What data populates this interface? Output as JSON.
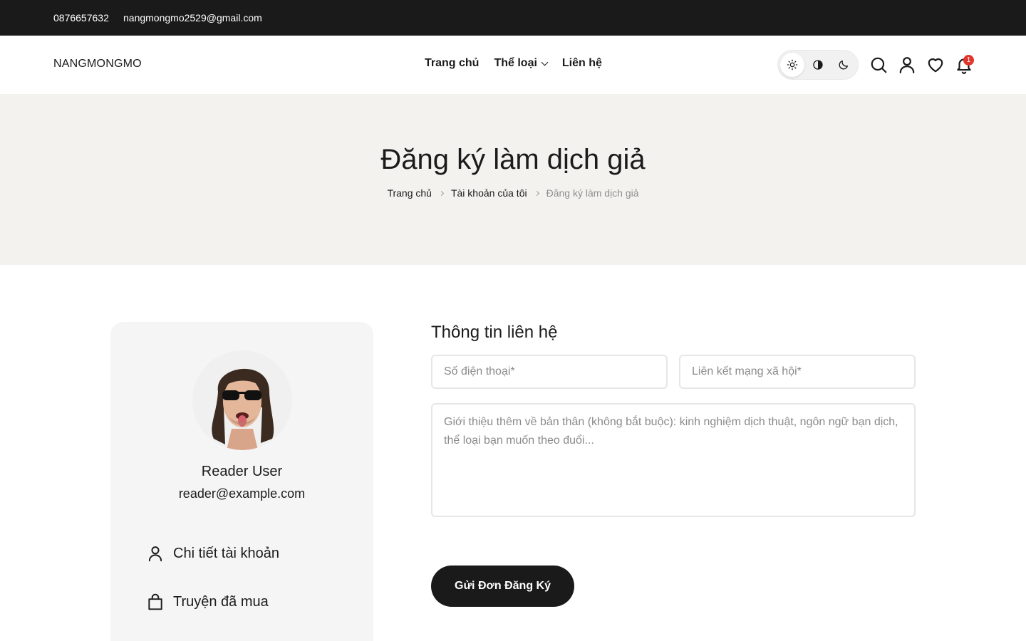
{
  "topbar": {
    "phone": "0876657632",
    "email": "nangmongmo2529@gmail.com"
  },
  "header": {
    "logo": "NANGMONGMO",
    "nav": [
      {
        "label": "Trang chủ"
      },
      {
        "label": "Thể loại",
        "has_dropdown": true
      },
      {
        "label": "Liên hệ"
      }
    ],
    "theme_modes": [
      "light-icon",
      "contrast-icon",
      "moon-icon"
    ],
    "active_theme": "light",
    "icons": [
      "search-icon",
      "user-icon",
      "heart-icon",
      "bell-icon"
    ],
    "notification_count": "1"
  },
  "hero": {
    "title": "Đăng ký làm dịch giả",
    "breadcrumb": [
      "Trang chủ",
      "Tài khoản của tôi",
      "Đăng ký làm dịch giả"
    ]
  },
  "sidebar": {
    "user_name": "Reader User",
    "user_email": "reader@example.com",
    "items": [
      {
        "label": "Chi tiết tài khoản",
        "icon": "user-icon"
      },
      {
        "label": "Truyện đã mua",
        "icon": "shopping-bag-icon"
      }
    ]
  },
  "form": {
    "title": "Thông tin liên hệ",
    "phone_placeholder": "Số điện thoại*",
    "social_placeholder": "Liên kết mạng xã hội*",
    "intro_placeholder": "Giới thiệu thêm về bản thân (không bắt buộc): kinh nghiệm dịch thuật, ngôn ngữ bạn dịch, thể loại bạn muốn theo đuổi...",
    "submit_label": "Gửi Đơn Đăng Ký"
  },
  "colors": {
    "topbar_bg": "#1a1a1a",
    "hero_bg": "#f3f2ef",
    "card_bg": "#f5f5f5",
    "button_bg": "#1a1a1a",
    "badge": "#e0362c"
  }
}
